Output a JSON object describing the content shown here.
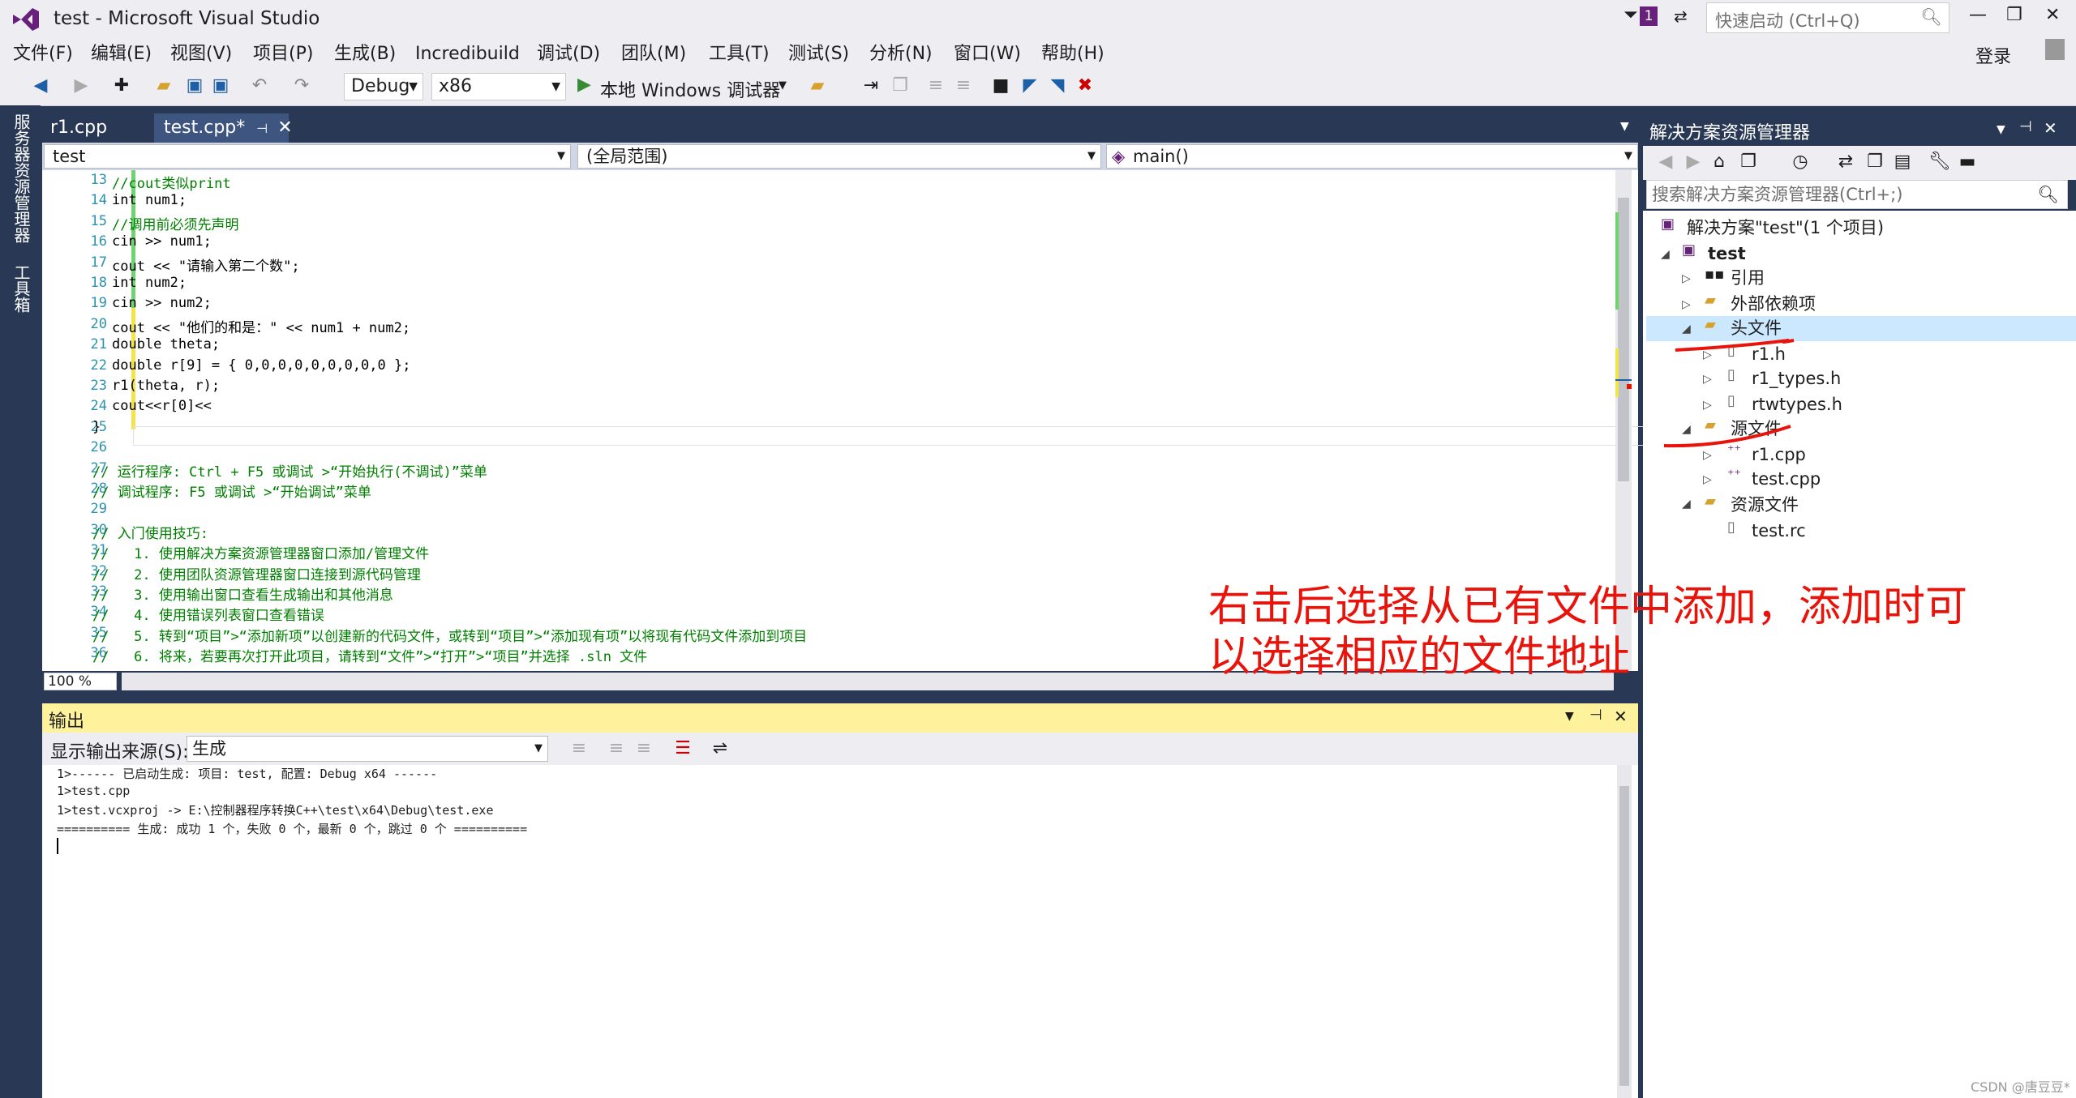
{
  "window": {
    "title": "test - Microsoft Visual Studio",
    "quick_launch_placeholder": "快速启动 (Ctrl+Q)",
    "notification_count": "1",
    "login": "登录"
  },
  "menu": [
    "文件(F)",
    "编辑(E)",
    "视图(V)",
    "项目(P)",
    "生成(B)",
    "Incredibuild",
    "调试(D)",
    "团队(M)",
    "工具(T)",
    "测试(S)",
    "分析(N)",
    "窗口(W)",
    "帮助(H)"
  ],
  "toolbar": {
    "config": "Debug",
    "platform": "x86",
    "debugger": "本地 Windows 调试器"
  },
  "left_strip": {
    "server_explorer": "服务器资源管理器",
    "toolbox": "工具箱"
  },
  "tabs": [
    {
      "label": "r1.cpp"
    },
    {
      "label": "test.cpp*"
    }
  ],
  "nav": {
    "project": "test",
    "scope": "(全局范围)",
    "member": "main()"
  },
  "code": [
    {
      "n": "13",
      "t": "//cout类似print"
    },
    {
      "n": "14",
      "t": "int num1;"
    },
    {
      "n": "15",
      "t": "//调用前必须先声明"
    },
    {
      "n": "16",
      "t": "cin >> num1;"
    },
    {
      "n": "17",
      "t": "cout << \"请输入第二个数\";"
    },
    {
      "n": "18",
      "t": "int num2;"
    },
    {
      "n": "19",
      "t": "cin >> num2;"
    },
    {
      "n": "20",
      "t": "cout << \"他们的和是：\" << num1 + num2;"
    },
    {
      "n": "21",
      "t": "double theta;"
    },
    {
      "n": "22",
      "t": "double r[9] = { 0,0,0,0,0,0,0,0,0 };"
    },
    {
      "n": "23",
      "t": "r1(theta, r);"
    },
    {
      "n": "24",
      "t": "cout<<r[0]<<"
    },
    {
      "n": "25",
      "t": "}"
    },
    {
      "n": "26",
      "t": ""
    },
    {
      "n": "27",
      "t": "// 运行程序: Ctrl + F5 或调试 >“开始执行(不调试)”菜单"
    },
    {
      "n": "28",
      "t": "// 调试程序: F5 或调试 >“开始调试”菜单"
    },
    {
      "n": "29",
      "t": ""
    },
    {
      "n": "30",
      "t": "// 入门使用技巧:"
    },
    {
      "n": "31",
      "t": "//   1. 使用解决方案资源管理器窗口添加/管理文件"
    },
    {
      "n": "32",
      "t": "//   2. 使用团队资源管理器窗口连接到源代码管理"
    },
    {
      "n": "33",
      "t": "//   3. 使用输出窗口查看生成输出和其他消息"
    },
    {
      "n": "34",
      "t": "//   4. 使用错误列表窗口查看错误"
    },
    {
      "n": "35",
      "t": "//   5. 转到“项目”>“添加新项”以创建新的代码文件，或转到“项目”>“添加现有项”以将现有代码文件添加到项目"
    },
    {
      "n": "36",
      "t": "//   6. 将来，若要再次打开此项目，请转到“文件”>“打开”>“项目”并选择 .sln 文件"
    }
  ],
  "zoom": "100 %",
  "output": {
    "title": "输出",
    "source_label": "显示输出来源(S):",
    "source_value": "生成",
    "lines": [
      "1>------ 已启动生成: 项目: test, 配置: Debug x64 ------",
      "1>test.cpp",
      "1>test.vcxproj -> E:\\控制器程序转换C++\\test\\x64\\Debug\\test.exe",
      "========== 生成: 成功 1 个，失败 0 个，最新 0 个，跳过 0 个 =========="
    ]
  },
  "solution_explorer": {
    "title": "解决方案资源管理器",
    "search_placeholder": "搜索解决方案资源管理器(Ctrl+;)",
    "solution": "解决方案\"test\"(1 个项目)",
    "project": "test",
    "references": "引用",
    "external_deps": "外部依赖项",
    "headers": "头文件",
    "header_files": [
      "r1.h",
      "r1_types.h",
      "rtwtypes.h"
    ],
    "sources": "源文件",
    "source_files": [
      "r1.cpp",
      "test.cpp"
    ],
    "resources": "资源文件",
    "resource_files": [
      "test.rc"
    ]
  },
  "annotation": {
    "line1": "右击后选择从已有文件中添加，添加时可",
    "line2": "以选择相应的文件地址"
  },
  "watermark": "CSDN @唐豆豆*",
  "colors": {
    "accent": "#293955",
    "output_header": "#fff29d",
    "annotation": "#e8140c",
    "selection": "#cce8ff"
  }
}
